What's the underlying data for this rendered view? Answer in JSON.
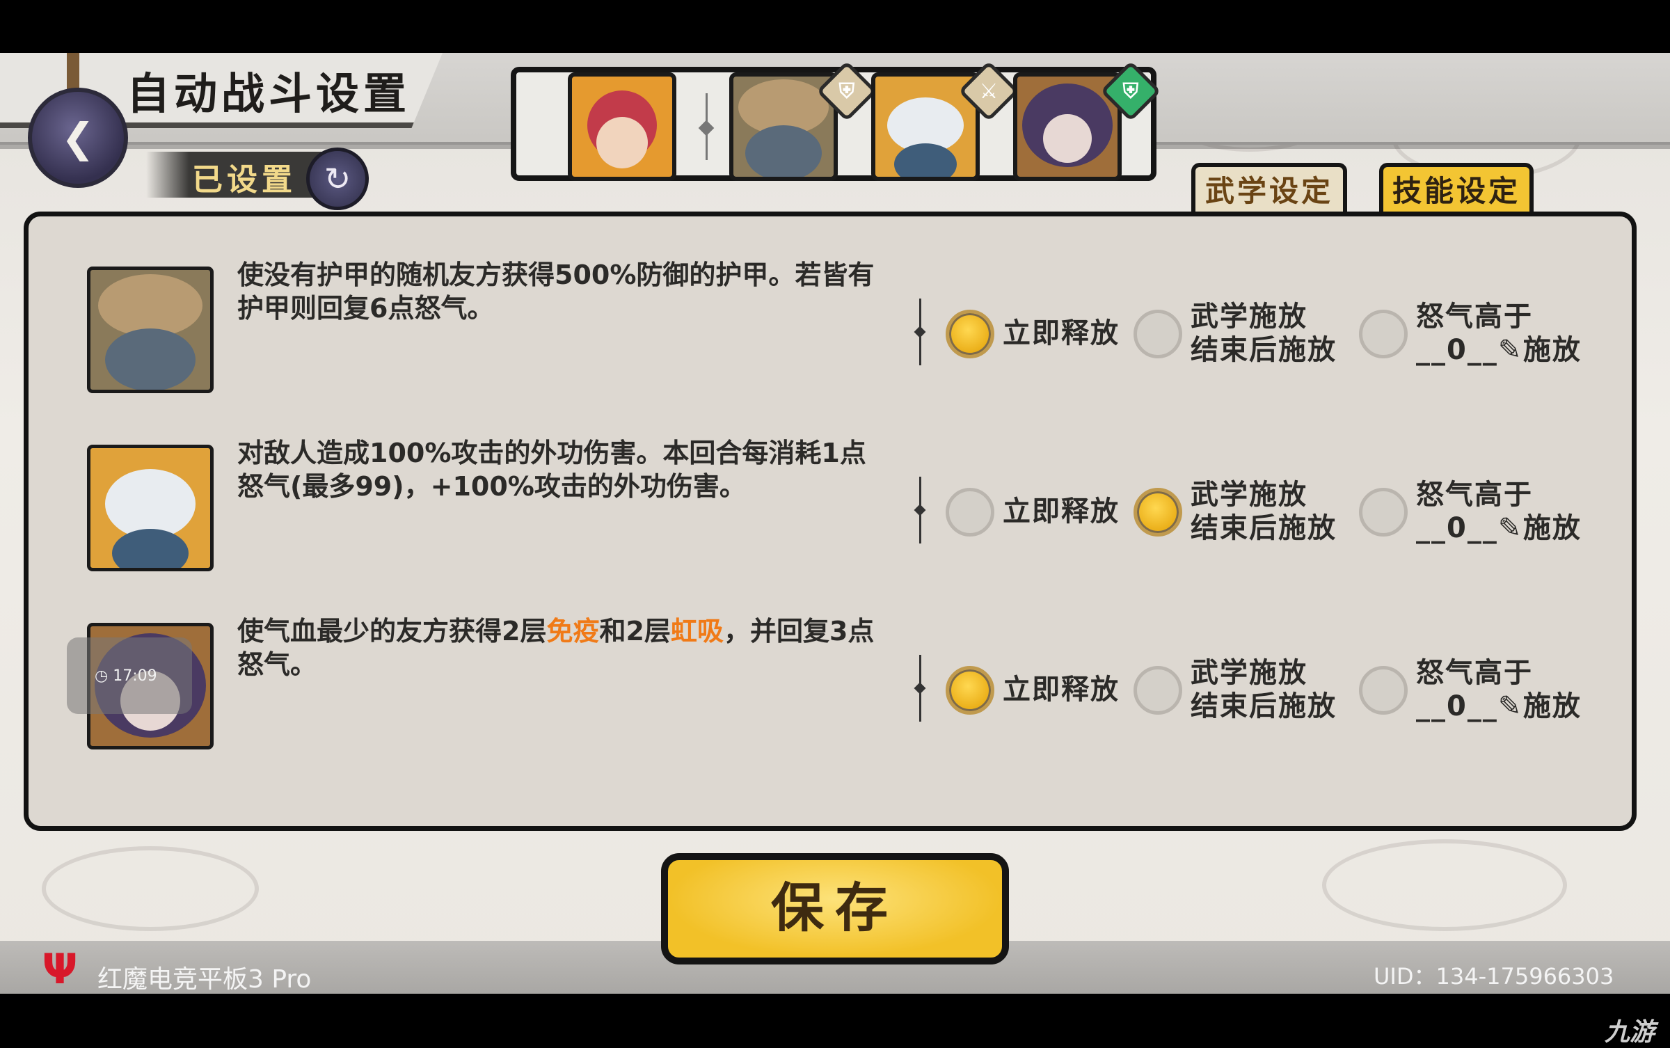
{
  "header": {
    "title": "自动战斗设置",
    "back_icon": "back-arrow-icon",
    "set_status": "已设置",
    "set_status_icon": "swirl-icon"
  },
  "team": {
    "members": [
      {
        "name": "leader-portrait",
        "role_icon": ""
      },
      {
        "name": "rock-hero-portrait",
        "role_icon": "shield-icon",
        "role_color": "#d9c9a8"
      },
      {
        "name": "mask-hero-portrait",
        "role_icon": "sword-icon",
        "role_color": "#d9c9a8"
      },
      {
        "name": "purple-hero-portrait",
        "role_icon": "shield-icon",
        "role_color": "#35b06a"
      }
    ]
  },
  "tabs": [
    {
      "label": "武学设定",
      "active": false
    },
    {
      "label": "技能设定",
      "active": true
    }
  ],
  "skills": [
    {
      "desc_line1": "使没有护甲的随机友方获得500%防御的护甲。若皆有",
      "desc_line2": "护甲则回复6点怒气。",
      "selected": "immediate"
    },
    {
      "desc_line1": "对敌人造成100%攻击的外功伤害。本回合每消耗1点",
      "desc_line2": "怒气(最多99)，+100%攻击的外功伤害。",
      "selected": "after_martial"
    },
    {
      "desc_parts": [
        "使气血最少的友方获得2层",
        "免疫",
        "和2层",
        "虹吸",
        "，并回复3点"
      ],
      "desc_line2": "怒气。",
      "selected": "immediate"
    }
  ],
  "options": {
    "immediate": "立即释放",
    "after_martial_line1": "武学施放",
    "after_martial_line2": "结束后施放",
    "rage_line1": "怒气高于",
    "rage_value": "__0__",
    "rage_suffix": "施放"
  },
  "save_button": "保存",
  "device": {
    "name": "红魔电竞平板3 Pro",
    "uid": "UID：134-175966303"
  },
  "overlay_time": "17:09",
  "watermark": "九游",
  "colors": {
    "accent_yellow": "#f3c533",
    "highlight_orange": "#f07a17",
    "panel_bg": "#ddd8d1"
  }
}
